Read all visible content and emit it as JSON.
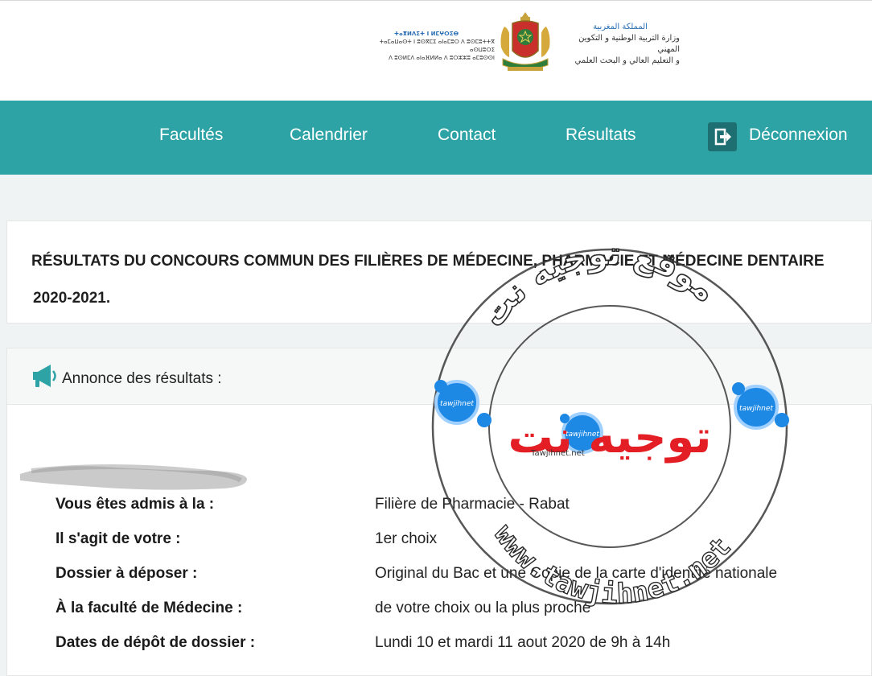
{
  "header": {
    "tifinagh_line1": "ⵜⴰⴳⵍⴷⵉⵜ ⵏ ⵍⵎⵖⵔⵉⴱ",
    "tifinagh_line2": "ⵜⴰⵎⴰⵡⴰⵙⵜ ⵏ ⵓⵙⴳⵎⵉ ⴰⵏⴰⵎⵓⵔ ⴷ ⵓⵙⵎⵓⵜⵜⴳ ⴰⵙⵡⵓⵔⵉ",
    "tifinagh_line3": "ⴷ ⵓⵙⵍⵎⴷ ⴰⵏⴰⴼⵍⵍⴰ ⴷ ⵓⵔⵣⵣⵓ ⴰⵎⵓⵙⵙⵏ",
    "arabic_line1": "المملكة المغربية",
    "arabic_line2": "وزارة التربية الوطنية و التكوين المهني",
    "arabic_line3": "و التعليم العالي و البحث العلمي"
  },
  "nav": {
    "facultes": "Facultés",
    "calendrier": "Calendrier",
    "contact": "Contact",
    "resultats": "Résultats",
    "deconnexion": "Déconnexion"
  },
  "title_card": {
    "title": "RÉSULTATS DU CONCOURS COMMUN DES FILIÈRES DE MÉDECINE, PHARMACIE ET MÉDECINE DENTAIRE",
    "year": "2020-2021."
  },
  "results": {
    "heading": "Annonce des résultats :",
    "rows": [
      {
        "label": "Vous êtes admis à la :",
        "value": "Filière de Pharmacie - Rabat"
      },
      {
        "label": "Il s'agit de votre :",
        "value": "1er choix"
      },
      {
        "label": "Dossier à déposer :",
        "value": "Original du Bac et une Copie de la carte d'identité nationale"
      },
      {
        "label": "À la faculté de Médecine :",
        "value": "de votre choix ou la plus proche"
      },
      {
        "label": "Dates de dépôt de dossier :",
        "value": "Lundi 10 et mardi 11 aout 2020 de 9h à 14h"
      }
    ]
  },
  "watermark": {
    "arabic_top": "موقع توجيه نت",
    "brand_arabic": "توجيه نت",
    "brand_latin": "tawjihnet",
    "url": "www.tawjihnet.net",
    "small_url": "Tawjihnet.net"
  },
  "colors": {
    "nav_bg": "#2ea3a6",
    "nav_icon_bg": "#1d6f72",
    "megaphone": "#2ea3a6",
    "watermark_red": "#e31e24",
    "watermark_blue": "#1e88e5"
  }
}
